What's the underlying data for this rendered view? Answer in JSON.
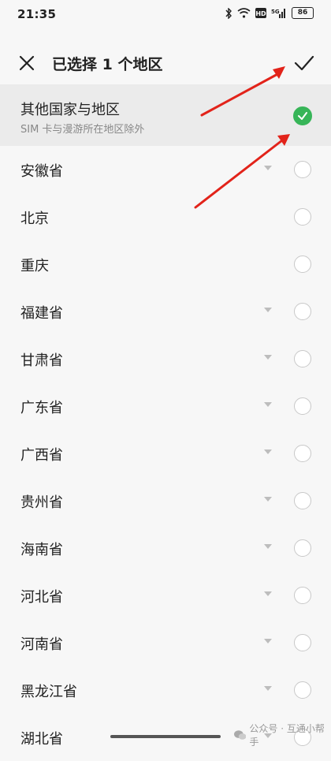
{
  "status": {
    "time": "21:35",
    "battery": "86",
    "icons": [
      "bluetooth-icon",
      "wifi-icon",
      "hd-icon",
      "signal-icon"
    ]
  },
  "header": {
    "title": "已选择 1 个地区",
    "close_icon": "close-icon",
    "confirm_icon": "check-icon"
  },
  "first_item": {
    "label": "其他国家与地区",
    "sublabel": "SIM 卡与漫游所在地区除外",
    "selected": true
  },
  "regions": [
    {
      "label": "安徽省",
      "expandable": true
    },
    {
      "label": "北京",
      "expandable": false
    },
    {
      "label": "重庆",
      "expandable": false
    },
    {
      "label": "福建省",
      "expandable": true
    },
    {
      "label": "甘肃省",
      "expandable": true
    },
    {
      "label": "广东省",
      "expandable": true
    },
    {
      "label": "广西省",
      "expandable": true
    },
    {
      "label": "贵州省",
      "expandable": true
    },
    {
      "label": "海南省",
      "expandable": true
    },
    {
      "label": "河北省",
      "expandable": true
    },
    {
      "label": "河南省",
      "expandable": true
    },
    {
      "label": "黑龙江省",
      "expandable": true
    },
    {
      "label": "湖北省",
      "expandable": true
    }
  ],
  "watermark": "公众号 · 互通小帮手",
  "colors": {
    "accent": "#37b558",
    "arrow": "#e2231a"
  }
}
